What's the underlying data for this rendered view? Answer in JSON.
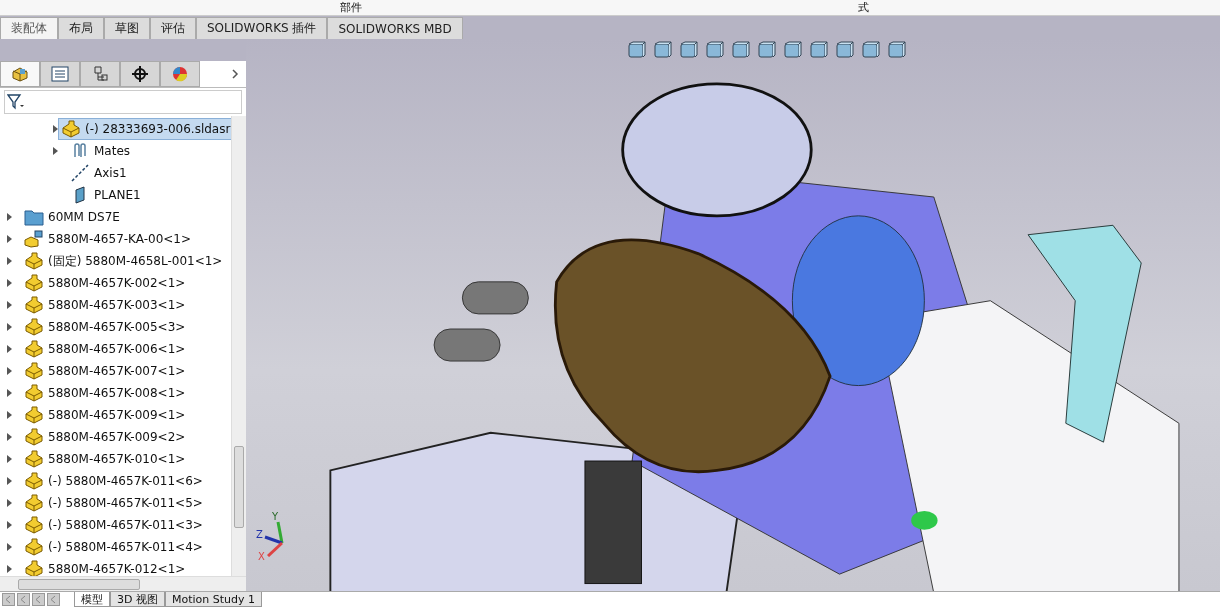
{
  "top_strip": {
    "labels": [
      "部件",
      "式"
    ]
  },
  "ribbon_tabs": [
    {
      "label": "装配体",
      "selected": true
    },
    {
      "label": "布局",
      "selected": false
    },
    {
      "label": "草图",
      "selected": false
    },
    {
      "label": "评估",
      "selected": false
    },
    {
      "label": "SOLIDWORKS 插件",
      "selected": false
    },
    {
      "label": "SOLIDWORKS MBD",
      "selected": false
    }
  ],
  "panel_tabs": [
    {
      "kind": "tree",
      "selected": true
    },
    {
      "kind": "properties",
      "selected": false
    },
    {
      "kind": "config",
      "selected": false
    },
    {
      "kind": "dimxpert",
      "selected": false
    },
    {
      "kind": "display",
      "selected": false
    }
  ],
  "tree": {
    "subitems": [
      {
        "label": "(-) 28333693-006.sldasr",
        "kind": "part",
        "expandable": true,
        "selected": true
      },
      {
        "label": "Mates",
        "kind": "mates",
        "expandable": true,
        "selected": false
      },
      {
        "label": "Axis1",
        "kind": "axis",
        "expandable": false,
        "selected": false
      },
      {
        "label": "PLANE1",
        "kind": "plane",
        "expandable": false,
        "selected": false
      }
    ],
    "items": [
      {
        "label": "60MM DS7E",
        "kind": "folder",
        "expandable": true,
        "selected": false
      },
      {
        "label": "5880M-4657-KA-00<1>",
        "kind": "subassembly",
        "expandable": true,
        "selected": false
      },
      {
        "label": "(固定) 5880M-4658L-001<1>",
        "kind": "part",
        "expandable": true,
        "selected": false
      },
      {
        "label": "5880M-4657K-002<1>",
        "kind": "part",
        "expandable": true,
        "selected": false
      },
      {
        "label": "5880M-4657K-003<1>",
        "kind": "part",
        "expandable": true,
        "selected": false
      },
      {
        "label": "5880M-4657K-005<3>",
        "kind": "part",
        "expandable": true,
        "selected": false
      },
      {
        "label": "5880M-4657K-006<1>",
        "kind": "part",
        "expandable": true,
        "selected": false
      },
      {
        "label": "5880M-4657K-007<1>",
        "kind": "part",
        "expandable": true,
        "selected": false
      },
      {
        "label": "5880M-4657K-008<1>",
        "kind": "part",
        "expandable": true,
        "selected": false
      },
      {
        "label": "5880M-4657K-009<1>",
        "kind": "part",
        "expandable": true,
        "selected": false
      },
      {
        "label": "5880M-4657K-009<2>",
        "kind": "part",
        "expandable": true,
        "selected": false
      },
      {
        "label": "5880M-4657K-010<1>",
        "kind": "part",
        "expandable": true,
        "selected": false
      },
      {
        "label": "(-) 5880M-4657K-011<6>",
        "kind": "part",
        "expandable": true,
        "selected": false
      },
      {
        "label": "(-) 5880M-4657K-011<5>",
        "kind": "part",
        "expandable": true,
        "selected": false
      },
      {
        "label": "(-) 5880M-4657K-011<3>",
        "kind": "part",
        "expandable": true,
        "selected": false
      },
      {
        "label": "(-) 5880M-4657K-011<4>",
        "kind": "part",
        "expandable": true,
        "selected": false
      },
      {
        "label": "5880M-4657K-012<1>",
        "kind": "part",
        "expandable": true,
        "selected": false
      }
    ]
  },
  "triad": {
    "x": "X",
    "y": "Y",
    "z": "Z"
  },
  "bottom_tabs": [
    {
      "label": "模型",
      "selected": true
    },
    {
      "label": "3D 视图",
      "selected": false
    },
    {
      "label": "Motion Study 1",
      "selected": false
    }
  ]
}
